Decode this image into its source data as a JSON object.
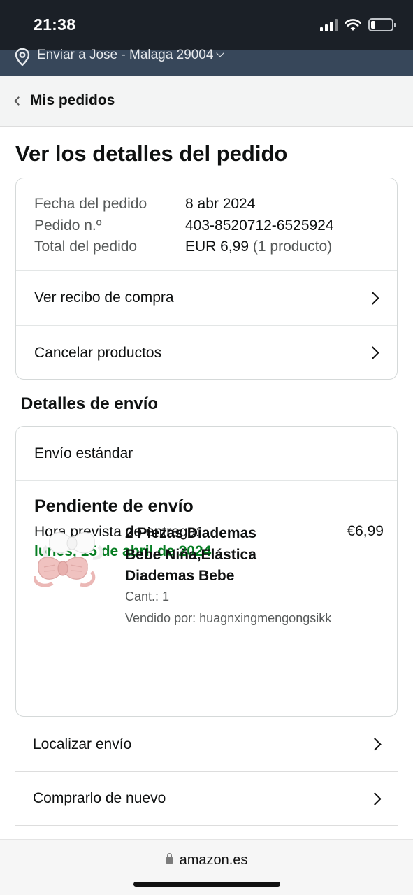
{
  "status_bar": {
    "time": "21:38",
    "battery_level": 0.2,
    "icons": [
      "cellular-signal-icon",
      "wifi-icon",
      "battery-icon"
    ]
  },
  "location": {
    "text": "Enviar a Jose - Malaga 29004",
    "icon": "location-pin-icon"
  },
  "nav": {
    "back_label": "Mis pedidos"
  },
  "page": {
    "title": "Ver los detalles del pedido"
  },
  "order_summary": {
    "rows": [
      {
        "label": "Fecha del pedido",
        "value": "8 abr 2024"
      },
      {
        "label": "Pedido n.º",
        "value": "403-8520712-6525924"
      },
      {
        "label": "Total del pedido",
        "value": "EUR 6,99",
        "extra": "(1 producto)"
      }
    ],
    "links": [
      {
        "label": "Ver recibo de compra"
      },
      {
        "label": "Cancelar productos"
      }
    ]
  },
  "shipping": {
    "section_title": "Detalles de envío",
    "method": "Envío estándar",
    "status": "Pendiente de envío",
    "eta_label": "Hora prevista de entrega:",
    "eta_date": "lunes, 15 de abril de 2024",
    "product": {
      "title": "2 Piezas Diademas Bebe Niña,Elástica Diademas Bebe",
      "price": "€6,99",
      "quantity": "Cant.: 1",
      "seller": "Vendido por: huagnxingmengongsikk"
    }
  },
  "actions": [
    {
      "label": "Localizar envío"
    },
    {
      "label": "Comprarlo de nuevo"
    }
  ],
  "browser": {
    "url": "amazon.es"
  },
  "colors": {
    "status_bar_bg": "#1b2027",
    "location_bar_bg": "#37475a",
    "eta_green": "#067d22",
    "border": "#d5d9d9"
  }
}
